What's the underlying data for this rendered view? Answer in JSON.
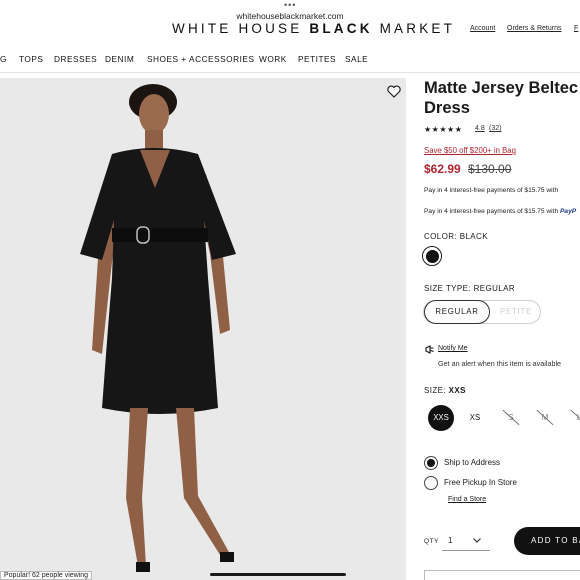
{
  "browser": {
    "url": "whitehouseblackmarket.com"
  },
  "header": {
    "logo_thin": "WHITE HOUSE ",
    "logo_bold": "BLACK",
    "logo_tail": " MARKET",
    "account": "Account",
    "orders": "Orders & Returns",
    "nav": [
      "G",
      "TOPS",
      "DRESSES",
      "DENIM",
      "SHOES + ACCESSORIES",
      "WORK",
      "PETITES",
      "SALE"
    ]
  },
  "image": {
    "popular_badge": "Popular! 62 people viewing"
  },
  "product": {
    "title_line1": "Matte Jersey Beltec",
    "title_line2": "Dress",
    "stars": "★★★★★",
    "rating": "4.8",
    "reviews": "(32)",
    "promo": "Save $50 off $200+ in Bag",
    "sale_price": "$62.99",
    "original_price": "$130.00",
    "installment_1": "Pay in 4 interest-free payments of $15.75 with",
    "installment_2": "Pay in 4 interest-free payments of $15.75 with",
    "installment_2_brand": "PayP",
    "color_label": "COLOR:",
    "color_value": "BLACK",
    "swatch_color": "#111111",
    "size_type_label": "SIZE TYPE: REGULAR",
    "size_types": [
      "REGULAR",
      "PETITE"
    ],
    "notify_link": "Notify Me",
    "alert_text": "Get an alert when this item is available",
    "size_label": "SIZE:",
    "size_value": "XXS",
    "sizes": [
      "XXS",
      "XS",
      "S",
      "M",
      "L"
    ],
    "ship_option": "Ship to Address",
    "pickup_option": "Free Pickup In Store",
    "find_store": "Find a Store",
    "qty_label": "QTY",
    "qty_value": "1",
    "add_to_bag": "ADD TO BA"
  },
  "colors": {
    "sale_red": "#b0252e",
    "paypal_blue": "#1b3a8a",
    "button_black": "#111111"
  }
}
